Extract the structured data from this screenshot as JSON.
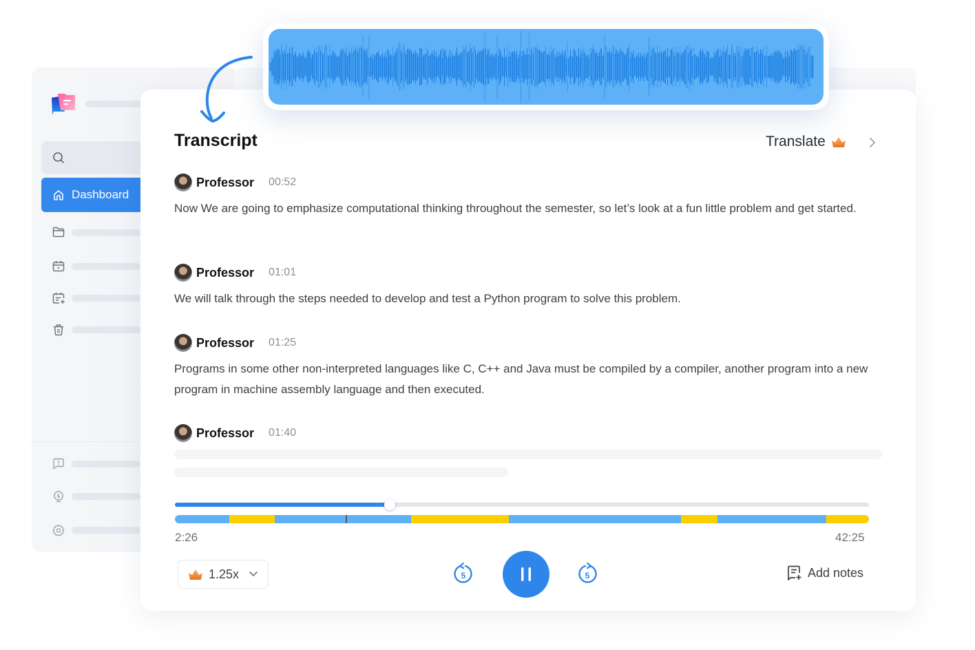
{
  "sidebar": {
    "logo_icon": "folder-chat-logo-icon",
    "search_icon": "search-icon",
    "active_item": {
      "label": "Dashboard",
      "icon": "home-icon"
    },
    "items": [
      {
        "icon": "folder-icon"
      },
      {
        "icon": "calendar-icon"
      },
      {
        "icon": "calendar-add-icon"
      },
      {
        "icon": "trash-icon"
      }
    ],
    "bottom_items": [
      {
        "icon": "feedback-icon"
      },
      {
        "icon": "lightbulb-icon"
      },
      {
        "icon": "gear-icon"
      }
    ]
  },
  "main": {
    "title": "Transcript",
    "translate": {
      "label": "Translate",
      "badge_icon": "crown-icon",
      "chevron_icon": "chevron-right-icon"
    },
    "entries": [
      {
        "speaker": "Professor",
        "time": "00:52",
        "text": "Now We are going to emphasize computational thinking throughout the semester, so let’s look at a fun little problem and get started."
      },
      {
        "speaker": "Professor",
        "time": "01:01",
        "text": "We will talk through the steps needed to develop and test a Python program to solve this problem."
      },
      {
        "speaker": "Professor",
        "time": "01:25",
        "text": "Programs in some other non-interpreted languages like C, C++ and Java must be compiled by a compiler, another program into a new program in machine assembly language and then executed."
      },
      {
        "speaker": "Professor",
        "time": "01:40",
        "text": ""
      }
    ]
  },
  "player": {
    "current_time": "2:26",
    "total_time": "42:25",
    "progress_fraction": 0.31,
    "segments": [
      {
        "type": "speech",
        "fraction": 0.078,
        "color": "#5fb1f7"
      },
      {
        "type": "highlight",
        "fraction": 0.066,
        "color": "#fccf00"
      },
      {
        "type": "speech",
        "fraction": 0.196,
        "color": "#5fb1f7"
      },
      {
        "type": "highlight",
        "fraction": 0.141,
        "color": "#fccf00"
      },
      {
        "type": "speech",
        "fraction": 0.248,
        "color": "#5fb1f7"
      },
      {
        "type": "highlight",
        "fraction": 0.053,
        "color": "#fccf00"
      },
      {
        "type": "speech",
        "fraction": 0.157,
        "color": "#5fb1f7"
      },
      {
        "type": "highlight",
        "fraction": 0.061,
        "color": "#fccf00"
      }
    ],
    "marker_fraction": 0.246,
    "speed": {
      "label": "1.25x",
      "badge_icon": "crown-icon"
    },
    "rewind_label": "5",
    "forward_label": "5",
    "add_notes_label": "Add notes"
  },
  "colors": {
    "accent": "#2f86ea",
    "highlight": "#fccf00",
    "waveform_bg": "#5fb1f7",
    "waveform_fg": "#1a7ee0"
  }
}
